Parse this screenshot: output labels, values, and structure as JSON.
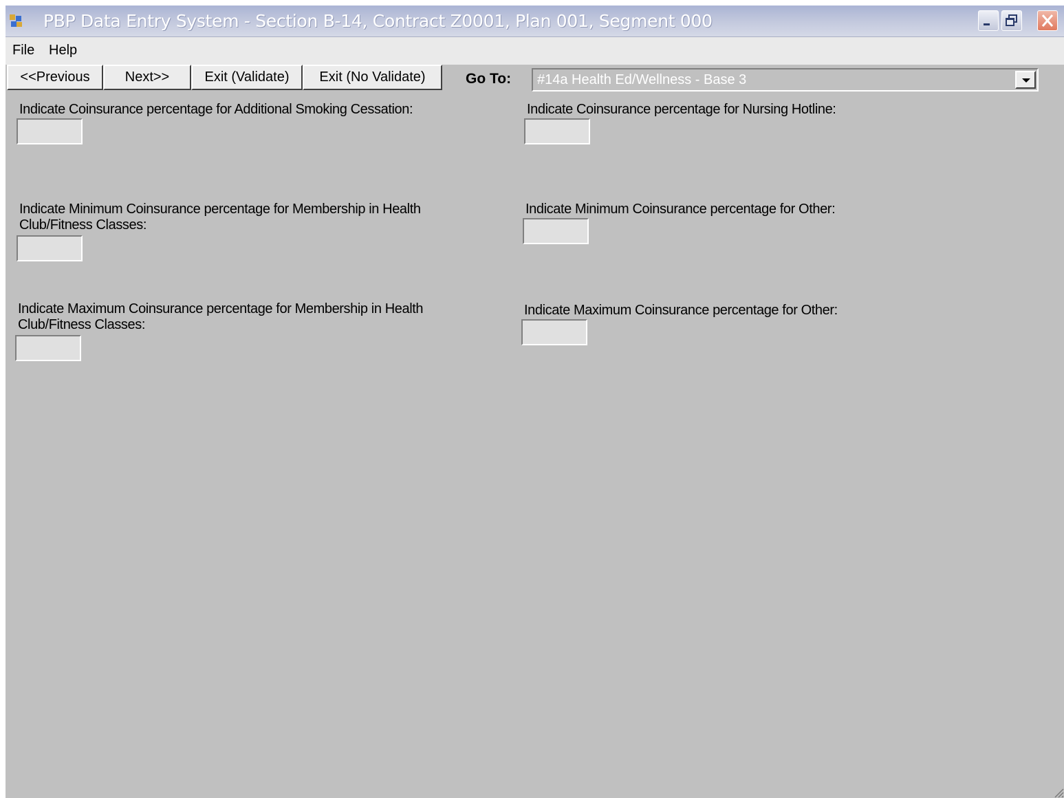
{
  "window": {
    "title": "PBP Data Entry System - Section B-14, Contract Z0001, Plan 001, Segment 000"
  },
  "menu": {
    "file": "File",
    "help": "Help"
  },
  "toolbar": {
    "previous": "<<Previous",
    "next": "Next>>",
    "exit_validate": "Exit (Validate)",
    "exit_no_validate": "Exit (No Validate)",
    "goto_label": "Go To:",
    "goto_value": "#14a Health Ed/Wellness - Base 3"
  },
  "fields": {
    "smoking": {
      "label": "Indicate Coinsurance percentage for Additional Smoking Cessation:",
      "value": ""
    },
    "nursing": {
      "label": "Indicate Coinsurance percentage for Nursing Hotline:",
      "value": ""
    },
    "min_health_club": {
      "label_line1": "Indicate Minimum Coinsurance percentage for Membership in Health",
      "label_line2": "Club/Fitness Classes:",
      "value": ""
    },
    "min_other": {
      "label": "Indicate Minimum Coinsurance percentage for Other:",
      "value": ""
    },
    "max_health_club": {
      "label_line1": "Indicate Maximum Coinsurance percentage for Membership in Health",
      "label_line2": "Club/Fitness Classes:",
      "value": ""
    },
    "max_other": {
      "label": "Indicate Maximum Coinsurance percentage for Other:",
      "value": ""
    }
  }
}
